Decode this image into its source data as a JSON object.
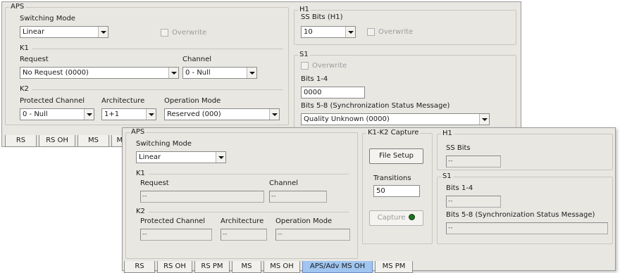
{
  "back": {
    "aps": {
      "title": "APS",
      "switching_mode_label": "Switching Mode",
      "switching_mode_value": "Linear",
      "overwrite_label": "Overwrite",
      "k1": {
        "title": "K1",
        "request_label": "Request",
        "request_value": "No Request (0000)",
        "channel_label": "Channel",
        "channel_value": "0 - Null"
      },
      "k2": {
        "title": "K2",
        "protected_channel_label": "Protected Channel",
        "protected_channel_value": "0 - Null",
        "architecture_label": "Architecture",
        "architecture_value": "1+1",
        "operation_mode_label": "Operation Mode",
        "operation_mode_value": "Reserved (000)"
      }
    },
    "h1": {
      "title": "H1",
      "ss_bits_label": "SS Bits (H1)",
      "ss_bits_value": "10",
      "overwrite_label": "Overwrite"
    },
    "s1": {
      "title": "S1",
      "overwrite_label": "Overwrite",
      "bits14_label": "Bits 1-4",
      "bits14_value": "0000",
      "bits58_label": "Bits 5-8 (Synchronization Status Message)",
      "bits58_value": "Quality Unknown (0000)"
    },
    "tabs": [
      "RS",
      "RS OH",
      "MS",
      "MS"
    ]
  },
  "front": {
    "aps": {
      "title": "APS",
      "switching_mode_label": "Switching Mode",
      "switching_mode_value": "Linear",
      "k1": {
        "title": "K1",
        "request_label": "Request",
        "request_value": "--",
        "channel_label": "Channel",
        "channel_value": "--"
      },
      "k2": {
        "title": "K2",
        "protected_channel_label": "Protected Channel",
        "protected_channel_value": "--",
        "architecture_label": "Architecture",
        "architecture_value": "--",
        "operation_mode_label": "Operation Mode",
        "operation_mode_value": "--"
      }
    },
    "capture": {
      "title": "K1-K2 Capture",
      "file_setup_label": "File Setup",
      "transitions_label": "Transitions",
      "transitions_value": "50",
      "capture_label": "Capture"
    },
    "h1": {
      "title": "H1",
      "ss_bits_label": "SS Bits",
      "ss_bits_value": "--"
    },
    "s1": {
      "title": "S1",
      "bits14_label": "Bits 1-4",
      "bits14_value": "--",
      "bits58_label": "Bits 5-8 (Synchronization Status Message)",
      "bits58_value": "--"
    },
    "tabs": [
      "RS",
      "RS OH",
      "RS PM",
      "MS",
      "MS OH",
      "APS/Adv MS OH",
      "MS PM"
    ],
    "active_tab": "APS/Adv MS OH"
  },
  "colors": {
    "panel_bg": "#e9e7e2",
    "active_tab": "#9fc5f0",
    "capture_led": "#1f6e1f"
  }
}
